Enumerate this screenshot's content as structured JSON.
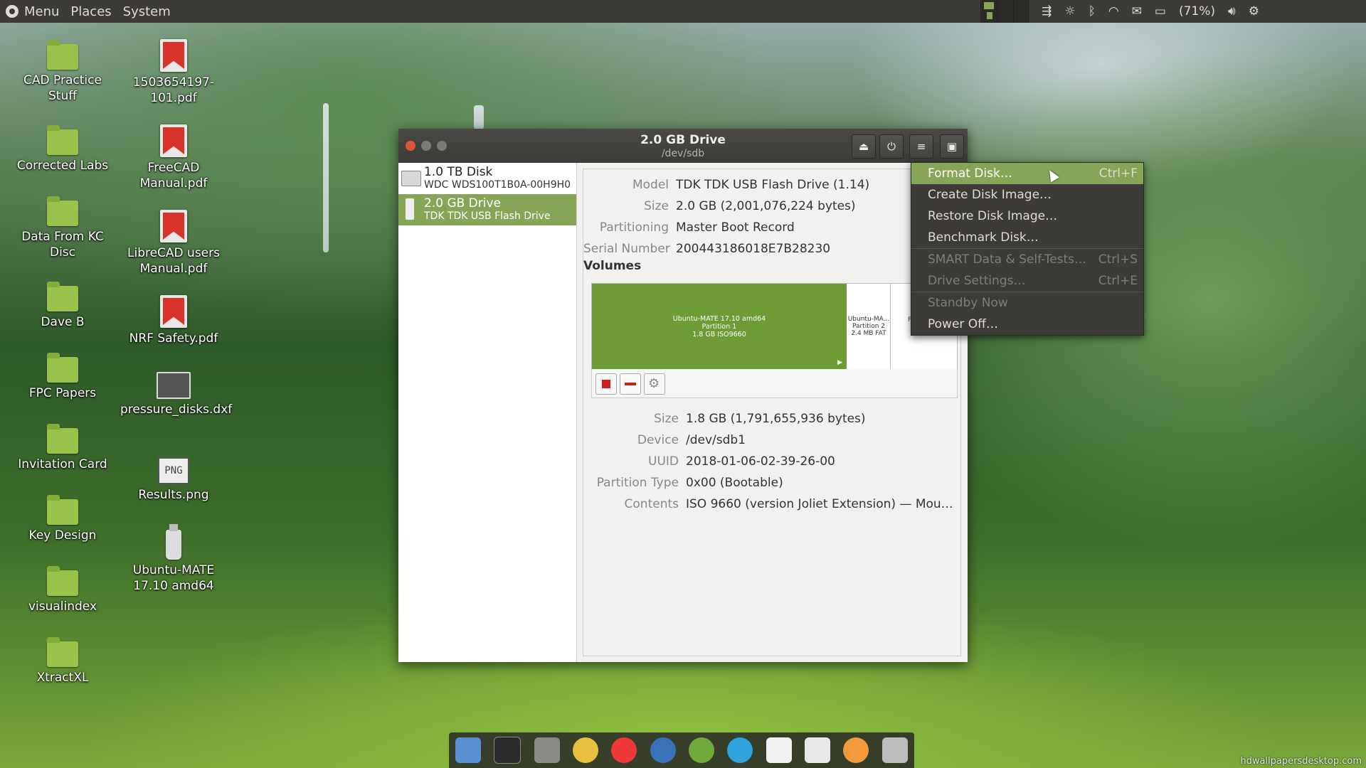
{
  "top_panel": {
    "menu_label": "Menu",
    "places_label": "Places",
    "system_label": "System",
    "battery_text": "(71%)"
  },
  "desktop_icons": {
    "col1": [
      {
        "label": "CAD Practice Stuff",
        "type": "folder"
      },
      {
        "label": "Corrected Labs",
        "type": "folder"
      },
      {
        "label": "Data From KC Disc",
        "type": "folder"
      },
      {
        "label": "Dave B",
        "type": "folder"
      },
      {
        "label": "FPC Papers",
        "type": "folder"
      },
      {
        "label": "Invitation Card",
        "type": "folder"
      },
      {
        "label": "Key Design",
        "type": "folder"
      },
      {
        "label": "visualindex",
        "type": "folder"
      },
      {
        "label": "XtractXL",
        "type": "folder"
      }
    ],
    "col2": [
      {
        "label": "1503654197-101.pdf",
        "type": "pdf"
      },
      {
        "label": "FreeCAD Manual.pdf",
        "type": "pdf"
      },
      {
        "label": "LibreCAD users Manual.pdf",
        "type": "pdf"
      },
      {
        "label": "NRF Safety.pdf",
        "type": "pdf"
      },
      {
        "label": "pressure_disks.dxf",
        "type": "dxf"
      },
      {
        "label": "Results.png",
        "type": "png",
        "badge": "PNG"
      },
      {
        "label": "Ubuntu-MATE 17.10 amd64",
        "type": "usb"
      }
    ]
  },
  "window": {
    "title": "2.0 GB Drive",
    "subtitle": "/dev/sdb",
    "drives": [
      {
        "name": "1.0 TB Disk",
        "model": "WDC WDS100T1B0A-00H9H0",
        "selected": false
      },
      {
        "name": "2.0 GB Drive",
        "model": "TDK TDK USB Flash Drive",
        "selected": true
      }
    ],
    "drive_info": {
      "model_label": "Model",
      "model_value": "TDK TDK USB Flash Drive (1.14)",
      "size_label": "Size",
      "size_value": "2.0 GB (2,001,076,224 bytes)",
      "partitioning_label": "Partitioning",
      "partitioning_value": "Master Boot Record",
      "serial_label": "Serial Number",
      "serial_value": "200443186018E7B28230"
    },
    "volumes_heading": "Volumes",
    "partitions": [
      {
        "name": "Ubuntu-MATE 17.10 amd64",
        "part": "Partition 1",
        "info": "1.8 GB ISO9660"
      },
      {
        "name": "Ubuntu-MA...",
        "part": "Partition 2",
        "info": "2.4 MB FAT"
      },
      {
        "name": "F",
        "part": "",
        "info": ""
      }
    ],
    "volume_info": {
      "size_label": "Size",
      "size_value": "1.8 GB (1,791,655,936 bytes)",
      "device_label": "Device",
      "device_value": "/dev/sdb1",
      "uuid_label": "UUID",
      "uuid_value": "2018-01-06-02-39-26-00",
      "ptype_label": "Partition Type",
      "ptype_value": "0x00 (Bootable)",
      "contents_label": "Contents",
      "contents_value": "ISO 9660 (version Joliet Extension) — Mou…"
    }
  },
  "drive_menu": {
    "items": [
      {
        "label": "Format Disk…",
        "accel": "Ctrl+F",
        "state": "highlighted"
      },
      {
        "label": "Create Disk Image…",
        "accel": "",
        "state": "normal"
      },
      {
        "label": "Restore Disk Image…",
        "accel": "",
        "state": "normal"
      },
      {
        "label": "Benchmark Disk…",
        "accel": "",
        "state": "normal"
      },
      {
        "label": "SMART Data & Self-Tests…",
        "accel": "Ctrl+S",
        "state": "disabled"
      },
      {
        "label": "Drive Settings…",
        "accel": "Ctrl+E",
        "state": "disabled"
      },
      {
        "label": "Standby Now",
        "accel": "",
        "state": "disabled"
      },
      {
        "label": "Power Off…",
        "accel": "",
        "state": "normal"
      }
    ]
  },
  "dock": {
    "apps": [
      "show-desktop",
      "terminal",
      "file-manager",
      "tux-app",
      "vivaldi",
      "thunderbird",
      "green-app",
      "telegram",
      "text-editor",
      "tex",
      "orange-app",
      "disks"
    ]
  },
  "watermark": "hdwallpapersdesktop.com",
  "colors": {
    "accent": "#87a556",
    "panel": "#3c3b37"
  }
}
